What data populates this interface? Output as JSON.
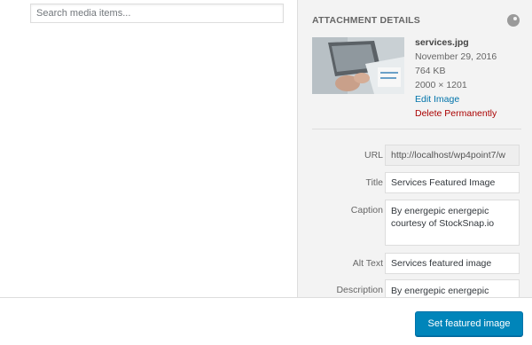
{
  "search": {
    "placeholder": "Search media items..."
  },
  "details": {
    "heading": "ATTACHMENT DETAILS",
    "filename": "services.jpg",
    "date": "November 29, 2016",
    "filesize": "764 KB",
    "dimensions": "2000 × 1201",
    "edit_link": "Edit Image",
    "delete_link": "Delete Permanently"
  },
  "fields": {
    "url": {
      "label": "URL",
      "value": "http://localhost/wp4point7/w"
    },
    "title": {
      "label": "Title",
      "value": "Services Featured Image"
    },
    "caption": {
      "label": "Caption",
      "value": "By energepic energepic courtesy of StockSnap.io"
    },
    "alt_text": {
      "label": "Alt Text",
      "value": "Services featured image"
    },
    "description": {
      "label": "Description",
      "value": "By energepic energepic"
    }
  },
  "toolbar": {
    "primary_label": "Set featured image"
  },
  "colors": {
    "primary": "#0085ba",
    "link": "#0073aa",
    "delete": "#aa0000"
  }
}
